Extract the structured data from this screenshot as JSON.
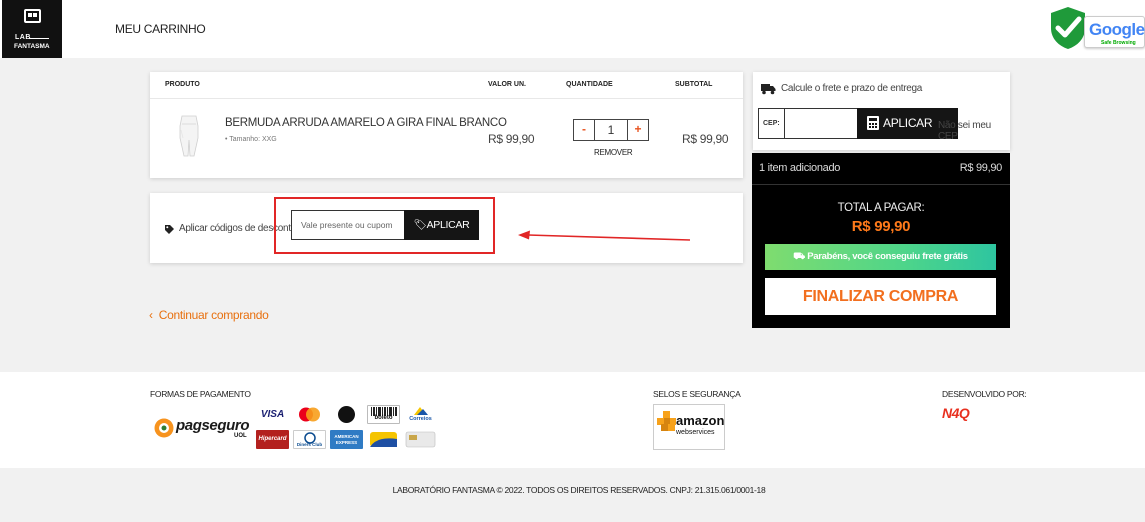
{
  "header": {
    "logo_line1": "LAB",
    "logo_line2": "FANTASMA",
    "title": "MEU CARRINHO",
    "safe_browsing_word": "Google",
    "safe_browsing_sub": "Safe Browsing"
  },
  "cart": {
    "columns": [
      "PRODUTO",
      "VALOR UN.",
      "QUANTIDADE",
      "SUBTOTAL"
    ],
    "items": [
      {
        "name": "BERMUDA ARRUDA AMARELO A GIRA FINAL BRANCO",
        "variant": "• Tamanho: XXG",
        "unit_price": "R$ 99,90",
        "quantity": "1",
        "minus": "-",
        "plus": "+",
        "remove_label": "REMOVER",
        "subtotal": "R$ 99,90"
      }
    ]
  },
  "coupon": {
    "label": "Aplicar códigos de desconto",
    "placeholder": "Vale presente ou cupom",
    "button": "APLICAR"
  },
  "continue_label": "Continuar comprando",
  "continue_chevron": "‹",
  "shipping": {
    "label": "Calcule o frete e prazo de entrega",
    "cep_label": "CEP:",
    "button": "APLICAR",
    "unknown_cep": "Não sei meu CEP"
  },
  "summary": {
    "items_added": "1 item adicionado",
    "items_price": "R$ 99,90",
    "total_label": "TOTAL A PAGAR:",
    "total_value": "R$ 99,90",
    "free_shipping": "Parabéns, você conseguiu frete grátis",
    "checkout": "FINALIZAR COMPRA"
  },
  "footer": {
    "payments_title": "FORMAS DE PAGAMENTO",
    "pagseguro_word": "pagseguro",
    "pagseguro_sub": "UOL",
    "cards": [
      "VISA",
      "mastercard",
      "elo",
      "boleto",
      "Correios",
      "Hipercard",
      "Diners Club",
      "AMERICAN EXPRESS",
      "aura"
    ],
    "security_title": "SELOS E SEGURANÇA",
    "amazon_word": "amazon",
    "amazon_sub": "webservices",
    "dev_title": "DESENVOLVIDO POR:",
    "dev_brand": "N4Q",
    "copyright": "LABORATÓRIO FANTASMA © 2022. TODOS OS DIREITOS RESERVADOS. CNPJ: 21.315.061/0001-18"
  },
  "colors": {
    "accent_orange": "#f26f1f",
    "highlight_red": "#e12626",
    "free_shipping_green": "#4ed58a",
    "dark": "#151515"
  }
}
